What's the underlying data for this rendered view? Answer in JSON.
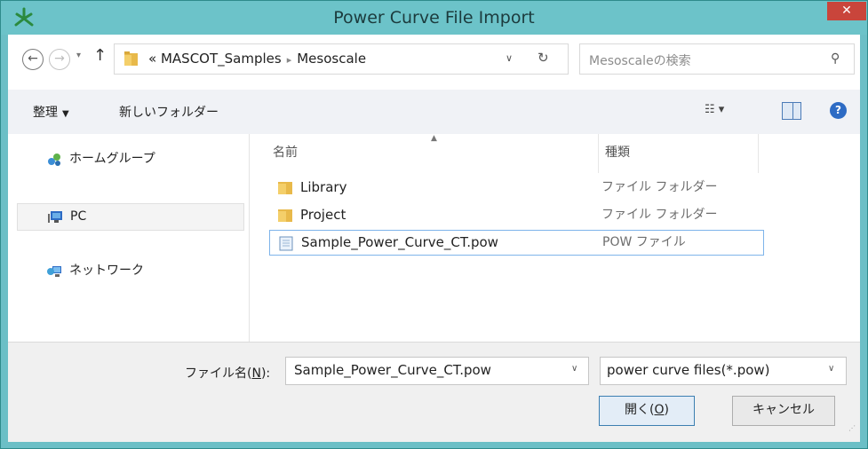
{
  "window": {
    "title": "Power Curve File Import",
    "close_label": "✕",
    "accent_color": "#6cc3c9",
    "close_color": "#c9453b"
  },
  "nav": {
    "back_icon": "←",
    "forward_icon": "→",
    "recent_icon": "▾",
    "up_icon": "↑",
    "breadcrumb_overflow": "«",
    "breadcrumb": [
      "MASCOT_Samples",
      "Mesoscale"
    ],
    "breadcrumb_sep": "▸",
    "address_dropdown_icon": "∨",
    "refresh_icon": "↻",
    "search_placeholder": "Mesoscaleの検索",
    "search_icon": "⚲"
  },
  "toolbar": {
    "organize_label": "整理",
    "organize_caret": "▼",
    "new_folder_label": "新しいフォルダー",
    "view_icon": "☷ ▾",
    "help_icon": "?"
  },
  "sidebar": {
    "items": [
      {
        "label": "ホームグループ",
        "icon": "homegroup-icon"
      },
      {
        "label": "PC",
        "icon": "pc-icon"
      },
      {
        "label": "ネットワーク",
        "icon": "network-icon"
      }
    ]
  },
  "files": {
    "sort_indicator": "▲",
    "columns": {
      "name": "名前",
      "type": "種類"
    },
    "rows": [
      {
        "name": "Library",
        "type": "ファイル フォルダー",
        "icon": "folder-icon"
      },
      {
        "name": "Project",
        "type": "ファイル フォルダー",
        "icon": "folder-icon"
      },
      {
        "name": "Sample_Power_Curve_CT.pow",
        "type": "POW ファイル",
        "icon": "document-icon"
      }
    ]
  },
  "footer": {
    "filename_label_pre": "ファイル名(",
    "filename_label_key": "N",
    "filename_label_post": "):",
    "filename_value": "Sample_Power_Curve_CT.pow",
    "filename_dropdown_icon": "∨",
    "filter_value": "power curve files(*.pow)",
    "filter_dropdown_icon": "∨",
    "open_pre": "開く(",
    "open_key": "O",
    "open_post": ")",
    "cancel_label": "キャンセル",
    "grip_icon": "⋰"
  }
}
